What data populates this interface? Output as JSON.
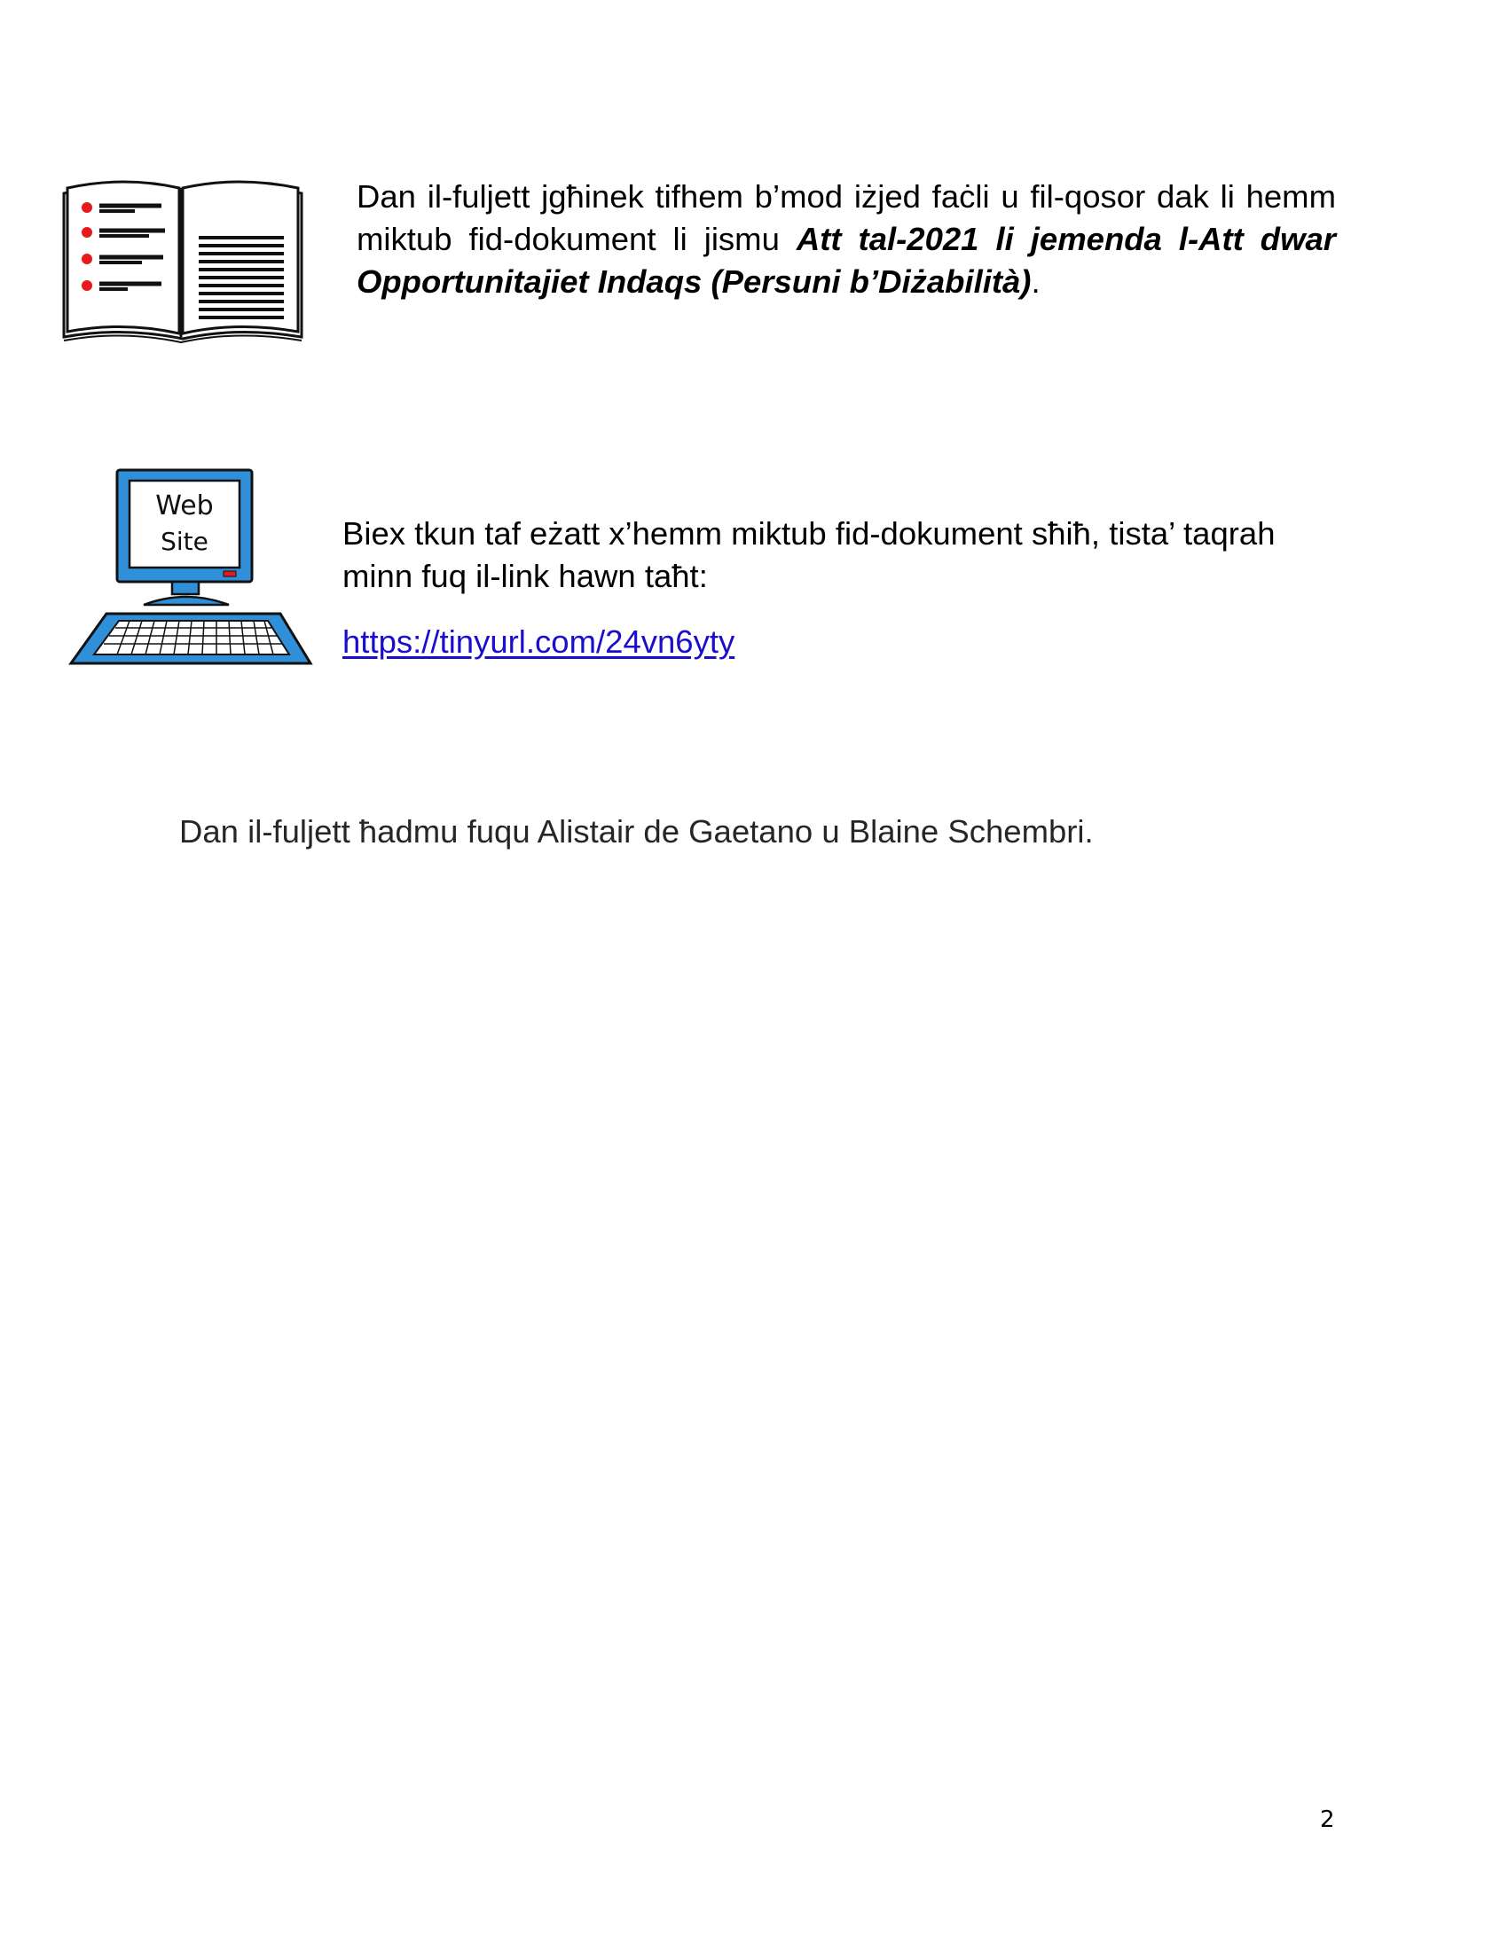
{
  "intro": {
    "text_before": "Dan il-fuljett jgħinek tifhem b’mod iżjed faċli u fil-qosor dak li hemm miktub fid-dokument li jismu ",
    "bold_title": "Att tal-2021 li jemenda l-Att dwar Opportunitajiet Indaqs (Persuni b’Diżabilità)",
    "text_after": "."
  },
  "web_section": {
    "icon_label_line1": "Web",
    "icon_label_line2": "Site",
    "text": "Biex tkun taf eżatt x’hemm miktub fid-dokument sħiħ, tista’ taqrah minn fuq il-link hawn taħt:",
    "link": "https://tinyurl.com/24vn6yty"
  },
  "credits": "Dan il-fuljett ħadmu fuqu Alistair de Gaetano u Blaine Schembri.",
  "page_number": "2",
  "icons": {
    "book": "open-book-icon",
    "computer": "computer-website-icon"
  },
  "colors": {
    "link": "#1a0dcc",
    "bullet_red": "#e8191c",
    "computer_blue": "#2f8fd8"
  }
}
